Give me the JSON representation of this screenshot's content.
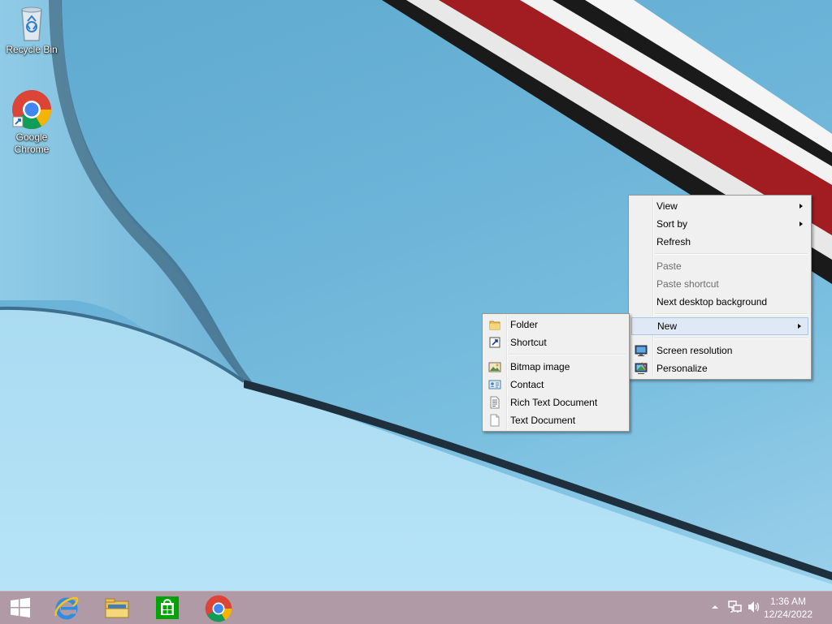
{
  "desktop": {
    "icons": [
      {
        "label": "Recycle Bin"
      },
      {
        "label": "Google Chrome"
      }
    ]
  },
  "context_menu": {
    "items": [
      {
        "label": "View",
        "disabled": false,
        "submenu": true
      },
      {
        "label": "Sort by",
        "disabled": false,
        "submenu": true
      },
      {
        "label": "Refresh",
        "disabled": false
      },
      {
        "label": "Paste",
        "disabled": true
      },
      {
        "label": "Paste shortcut",
        "disabled": true
      },
      {
        "label": "Next desktop background",
        "disabled": false
      },
      {
        "label": "New",
        "disabled": false,
        "submenu": true,
        "highlighted": true
      },
      {
        "label": "Screen resolution",
        "disabled": false
      },
      {
        "label": "Personalize",
        "disabled": false
      }
    ]
  },
  "new_submenu": {
    "items": [
      {
        "label": "Folder"
      },
      {
        "label": "Shortcut"
      },
      {
        "label": "Bitmap image"
      },
      {
        "label": "Contact"
      },
      {
        "label": "Rich Text Document"
      },
      {
        "label": "Text Document"
      }
    ]
  },
  "taskbar": {
    "clock_time": "1:36 AM",
    "clock_date": "12/24/2022"
  },
  "colors": {
    "taskbar": "#b09aa5",
    "menu_bg": "#f0f0f0",
    "highlight": "#dfe9f5"
  }
}
